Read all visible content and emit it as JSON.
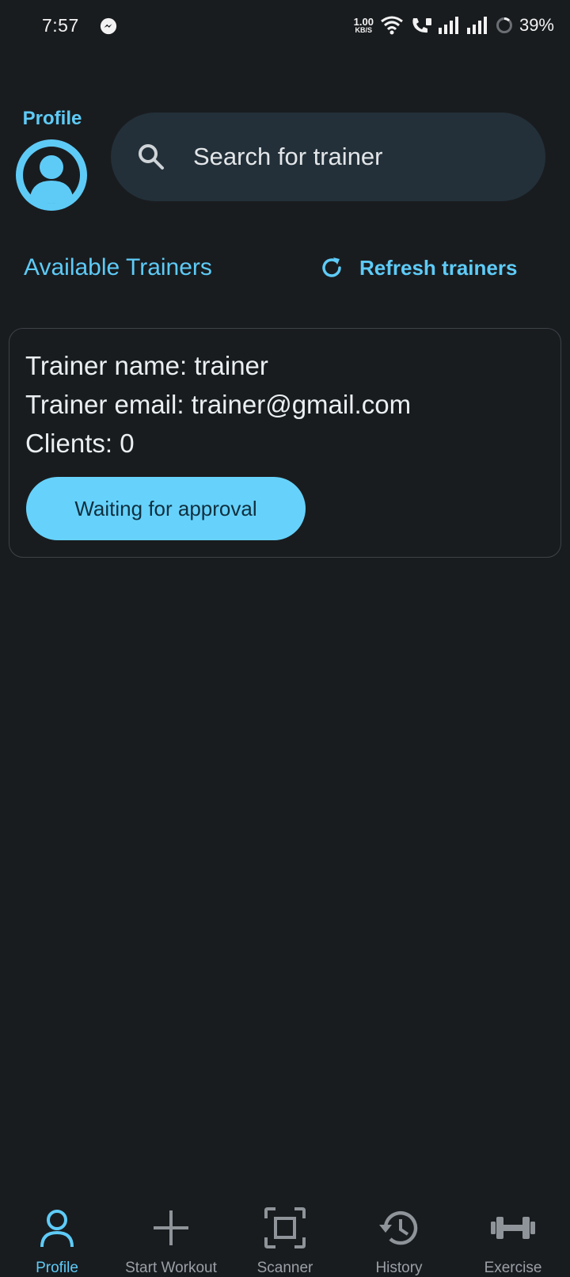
{
  "status_bar": {
    "time": "7:57",
    "speed_value": "1.00",
    "speed_unit": "KB/S",
    "battery": "39%"
  },
  "header": {
    "profile_label": "Profile",
    "search_placeholder": "Search for trainer"
  },
  "trainers_section": {
    "title": "Available Trainers",
    "refresh_label": "Refresh trainers"
  },
  "trainer_card": {
    "name_line": "Trainer name: trainer",
    "email_line": "Trainer email: trainer@gmail.com",
    "clients_line": "Clients: 0",
    "button_label": "Waiting for approval"
  },
  "bottom_nav": {
    "items": [
      {
        "label": "Profile",
        "icon": "person-icon",
        "active": true
      },
      {
        "label": "Start Workout",
        "icon": "plus-icon",
        "active": false
      },
      {
        "label": "Scanner",
        "icon": "scanner-icon",
        "active": false
      },
      {
        "label": "History",
        "icon": "history-icon",
        "active": false
      },
      {
        "label": "Exercise",
        "icon": "dumbbell-icon",
        "active": false
      }
    ]
  },
  "colors": {
    "background": "#191c1f",
    "accent": "#5ecbf7",
    "search_bg": "#233039",
    "button_bg": "#66d2fb",
    "inactive": "#9aa0a6"
  }
}
